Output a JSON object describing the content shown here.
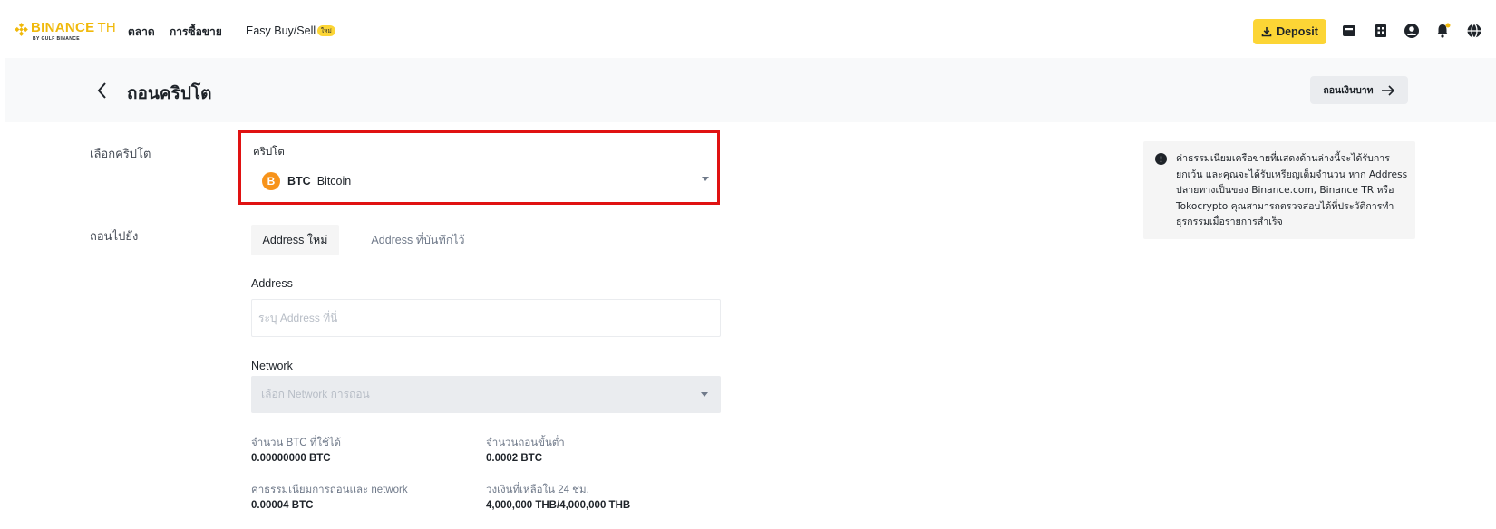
{
  "brand": {
    "name": "BINANCE",
    "suffix": "TH",
    "sub": "BY GULF BINANCE",
    "color": "#f0b90b"
  },
  "nav": {
    "items": [
      {
        "label": "ตลาด"
      },
      {
        "label": "การซื้อขาย"
      },
      {
        "label": "Easy Buy/Sell"
      }
    ],
    "new_badge": "ใหม่"
  },
  "header_actions": {
    "deposit_label": "Deposit",
    "icons": [
      "wallet-icon",
      "orders-icon",
      "user-icon",
      "notification-bell-icon",
      "globe-icon"
    ],
    "accent_color": "#fcd535"
  },
  "page": {
    "title": "ถอนคริปโต",
    "thb_withdraw_label": "ถอนเงินบาท"
  },
  "form": {
    "select_crypto_label": "เลือกคริปโต",
    "crypto_field_label": "คริปโต",
    "selected_coin": {
      "symbol": "BTC",
      "name": "Bitcoin",
      "icon_letter": "B"
    },
    "withdraw_to_label": "ถอนไปยัง",
    "tabs": [
      {
        "label": "Address ใหม่",
        "active": true
      },
      {
        "label": "Address ที่บันทึกไว้",
        "active": false
      }
    ],
    "address_label": "Address",
    "address_placeholder": "ระบุ Address ที่นี่",
    "address_value": "",
    "network_label": "Network",
    "network_placeholder": "เลือก Network การถอน"
  },
  "stats": {
    "available_label": "จำนวน BTC ที่ใช้ได้",
    "available_value": "0.00000000 BTC",
    "min_withdraw_label": "จำนวนถอนขั้นต่ำ",
    "min_withdraw_value": "0.0002 BTC",
    "fee_label": "ค่าธรรมเนียมการถอนและ network",
    "fee_value": "0.00004 BTC",
    "limit_label": "วงเงินที่เหลือใน 24 ชม.",
    "limit_value": "4,000,000 THB/4,000,000 THB"
  },
  "notice": {
    "icon_letter": "!",
    "text": "ค่าธรรมเนียมเครือข่ายที่แสดงด้านล่างนี้จะได้รับการยกเว้น และคุณจะได้รับเหรียญเต็มจำนวน หาก Address ปลายทางเป็นของ Binance.com, Binance TR หรือ Tokocrypto คุณสามารถตรวจสอบได้ที่ประวัติการทำธุรกรรมเมื่อรายการสำเร็จ"
  },
  "highlight_color": "#e01212"
}
